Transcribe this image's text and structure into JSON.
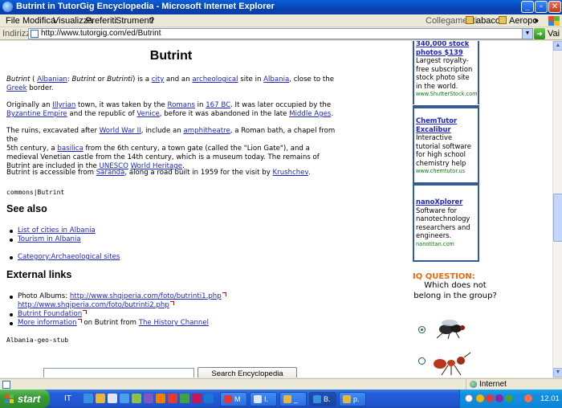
{
  "window": {
    "title": "Butrint in TutorGig Encyclopedia - Microsoft Internet Explorer"
  },
  "menu": {
    "items": [
      "File",
      "Modifica",
      "Visualizza",
      "Preferiti",
      "Strumenti",
      "?"
    ],
    "links_label": "Collegamenti",
    "links": [
      "abaco",
      "Aeropo"
    ],
    "overflow": "»"
  },
  "address": {
    "label": "Indirizzo",
    "url": "http://www.tutorgig.com/ed/Butrint",
    "go_label": "Vai"
  },
  "article": {
    "title": "Butrint",
    "intro": {
      "a": "Butrint",
      "b": " ( ",
      "albanian": "Albanian",
      "c": ": ",
      "d": "Butrint",
      "e": " or ",
      "f": "Butrinti",
      "g": ") is a ",
      "city": "city",
      "h": " and an ",
      "archeological": "archeological",
      "i": " site in ",
      "albania": "Albania",
      "j": ", close to the",
      "greek": "Greek",
      "k": " border."
    },
    "p2": {
      "a": "Originally an ",
      "illyrian": "Illyrian",
      "b": " town, it was taken by the ",
      "romans": "Romans",
      "c": " in ",
      "bc": "167 BC",
      "d": ". It was later occupied by the",
      "byzantine": "Byzantine Empire",
      "e": " and the republic of ",
      "venice": "Venice",
      "f": ", before it was abandoned in the late ",
      "middle": "Middle Ages",
      "g": "."
    },
    "p3": {
      "a": "The ruins, excavated after ",
      "ww2": "World War II",
      "b": ", include an ",
      "amph": "amphitheatre",
      "c": ", a Roman bath, a chapel from the",
      "d": "5th century, a ",
      "basilica": "basilica",
      "e": " from the 6th century, a town gate (called the \"Lion Gate\"), and a",
      "f": "medieval Venetian castle from the 14th century, which is a museum today. The remains of",
      "g": "Butrint are included in the ",
      "unesco": "UNESCO",
      "whl": "World Heritage",
      "h": "."
    },
    "p4": {
      "a": "Butrint is accessible from ",
      "saranda": "Saranda",
      "b": ", along a road built in 1959 for the visit by ",
      "krushchev": "Krushchev",
      "c": "."
    },
    "commons": "commons|Butrint",
    "see_also_heading": "See also",
    "see_also": [
      "List of cities in Albania",
      "Tourism in Albania"
    ],
    "category": "Category:Archaeological sites",
    "external_heading": "External links",
    "ext": {
      "photo_label": "Photo Albums: ",
      "photo1": "http://www.shqiperia.com/foto/butrinti1.php",
      "photo2": "http://www.shqiperia.com/foto/butrinti2.php",
      "foundation": "Butrint Foundation",
      "more_info": "More information",
      "on_butrint": " on Butrint from ",
      "history": "The History Channel"
    },
    "stub": "Albania-geo-stub"
  },
  "search": {
    "value": "",
    "button": "Search Encyclopedia"
  },
  "ads": [
    {
      "head": "340,000 stock photos $139",
      "body": "Largest royalty-free subscription stock photo site in the world.",
      "url": "www.ShutterStock.com"
    },
    {
      "head": "ChemTutor Excalibur",
      "body": "Interactive tutorial software for high school chemistry help",
      "url": "www.chemtutor.us"
    },
    {
      "head": "nanoXplorer",
      "body": "Software for nanotechnology researchers and engineers.",
      "url": "nanotitan.com"
    }
  ],
  "iq": {
    "title": "IQ QUESTION:",
    "question": "Which does not belong in the group?",
    "selected_option": 1
  },
  "status": {
    "zone": "Internet"
  },
  "taskbar": {
    "start": "start",
    "lang": "IT",
    "tasks": [
      "M",
      "I.",
      "_",
      "B.",
      "p."
    ],
    "clock": "12.01"
  },
  "colors": {
    "link": "#1f25c4",
    "ad_border": "#365a95",
    "iq_title": "#e86a10",
    "ad_url": "#0a7a0a"
  }
}
